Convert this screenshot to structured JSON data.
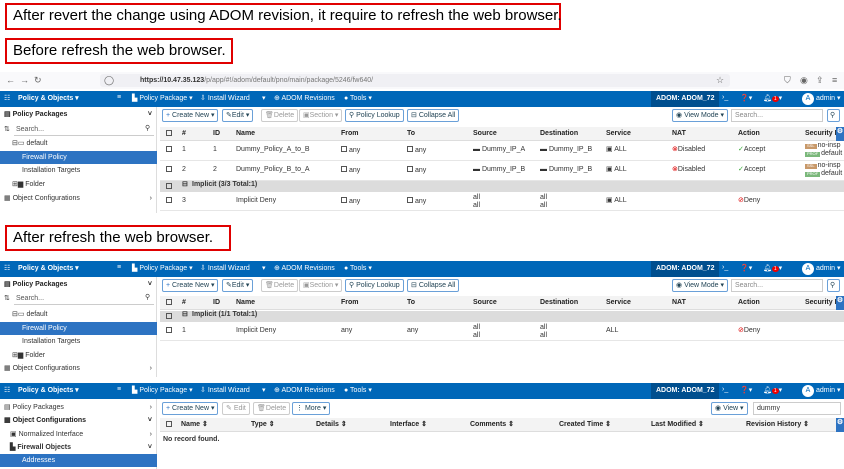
{
  "callouts": {
    "top": "After revert the change using ADOM revision, it require to refresh the web browser.",
    "before": "Before refresh the web browser.",
    "after": "After refresh the web browser."
  },
  "browser": {
    "url_host": "https://10.47.35.123",
    "url_path": "/p/app/#!/adom/default/pno/main/package/5246/fw640/"
  },
  "nav": {
    "app": "Policy & Objects ▾",
    "policy_package": "Policy Package ▾",
    "install_wizard": "Install Wizard",
    "adom_revisions": "ADOM Revisions",
    "tools": "Tools ▾",
    "adom": "ADOM: ADOM_72",
    "notification_count": "1",
    "avatar": "A",
    "user": "admin ▾"
  },
  "sidebar": {
    "policy_packages": "Policy Packages",
    "search_placeholder": "Search...",
    "default": "default",
    "firewall_policy": "Firewall Policy",
    "installation_targets": "Installation Targets",
    "folder": "Folder",
    "object_configurations": "Object Configurations",
    "normalized_interface": "Normalized Interface",
    "firewall_objects": "Firewall Objects",
    "addresses": "Addresses"
  },
  "toolbar": {
    "create_new": "Create New ▾",
    "edit": "Edit ▾",
    "edit_plain": "Edit",
    "delete": "Delete",
    "section": "Section ▾",
    "policy_lookup": "Policy Lookup",
    "collapse_all": "Collapse All",
    "view_mode": "View Mode ▾",
    "view": "View ▾",
    "more": "More ▾",
    "search_placeholder": "Search...",
    "object_search_value": "dummy"
  },
  "policy_columns": [
    "#",
    "ID",
    "Name",
    "From",
    "To",
    "Source",
    "Destination",
    "Service",
    "NAT",
    "Action",
    "Security P"
  ],
  "before": {
    "rows": [
      {
        "num": "1",
        "id": "1",
        "name": "Dummy_Policy_A_to_B",
        "from": "any",
        "to": "any",
        "source": "Dummy_IP_A",
        "destination": "Dummy_IP_B",
        "service": "ALL",
        "nat": "Disabled",
        "action": "Accept",
        "ssl": "no-insp",
        "prof": "default"
      },
      {
        "num": "2",
        "id": "2",
        "name": "Dummy_Policy_B_to_A",
        "from": "any",
        "to": "any",
        "source": "Dummy_IP_B",
        "destination": "Dummy_IP_B",
        "service": "ALL",
        "nat": "Disabled",
        "action": "Accept",
        "ssl": "no-insp",
        "prof": "default"
      }
    ],
    "group": "Implicit (3/3 Total:1)",
    "implicit": {
      "num": "3",
      "name": "Implicit Deny",
      "from": "any",
      "to": "any",
      "source": "all",
      "source2": "all",
      "destination": "all",
      "destination2": "all",
      "service": "ALL",
      "action": "Deny"
    }
  },
  "after": {
    "group": "Implicit (1/1 Total:1)",
    "implicit": {
      "num": "1",
      "name": "Implicit Deny",
      "from": "any",
      "to": "any",
      "source": "all",
      "source2": "all",
      "destination": "all",
      "destination2": "all",
      "service": "ALL",
      "action": "Deny"
    }
  },
  "tags": {
    "ssl": "SSL",
    "prof": "PROF"
  },
  "objects": {
    "columns": [
      "Name ⇕",
      "Type ⇕",
      "Details ⇕",
      "Interface ⇕",
      "Comments ⇕",
      "Created Time ⇕",
      "Last Modified ⇕",
      "Revision History ⇕"
    ],
    "empty": "No record found."
  },
  "colors": {
    "nav": "#0067b8",
    "selected": "#2d73c2",
    "callout_border": "#e00000"
  }
}
